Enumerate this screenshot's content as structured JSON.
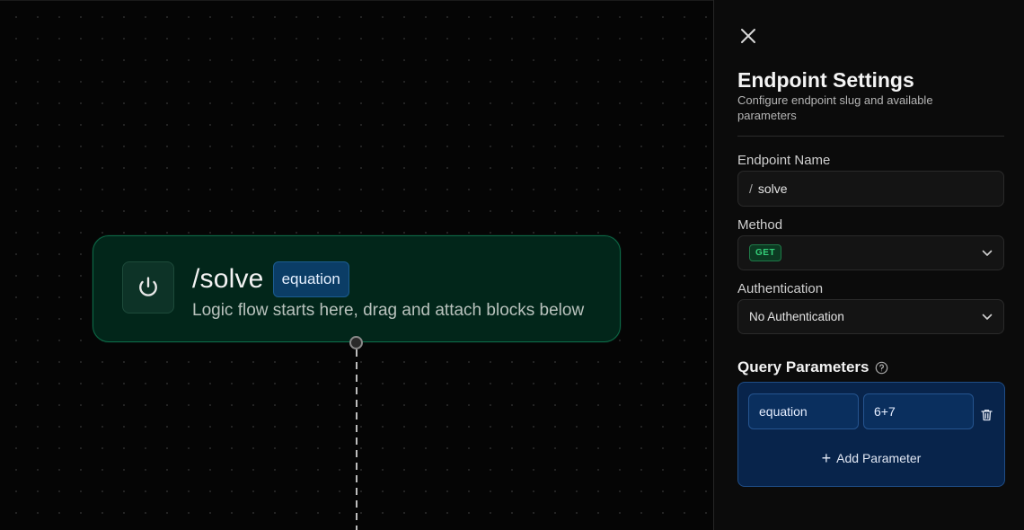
{
  "canvas": {
    "node": {
      "title": "/solve",
      "param_badge": "equation",
      "description": "Logic flow starts here, drag and attach blocks below",
      "icon": "power-icon"
    }
  },
  "panel": {
    "close_icon": "close-icon",
    "title": "Endpoint Settings",
    "subtitle": "Configure endpoint slug and available parameters",
    "endpoint_name": {
      "label": "Endpoint Name",
      "prefix": "/",
      "value": "solve"
    },
    "method": {
      "label": "Method",
      "value": "GET"
    },
    "authentication": {
      "label": "Authentication",
      "value": "No Authentication"
    },
    "query_parameters": {
      "title": "Query Parameters",
      "help_icon": "question-circle-icon",
      "items": [
        {
          "name": "equation",
          "value": "6+7"
        }
      ],
      "add_label": "Add Parameter"
    }
  },
  "colors": {
    "node_bg": "#02261a",
    "node_border": "#0d6a47",
    "param_box_bg": "#08244b",
    "method_green": "#34d17a"
  }
}
